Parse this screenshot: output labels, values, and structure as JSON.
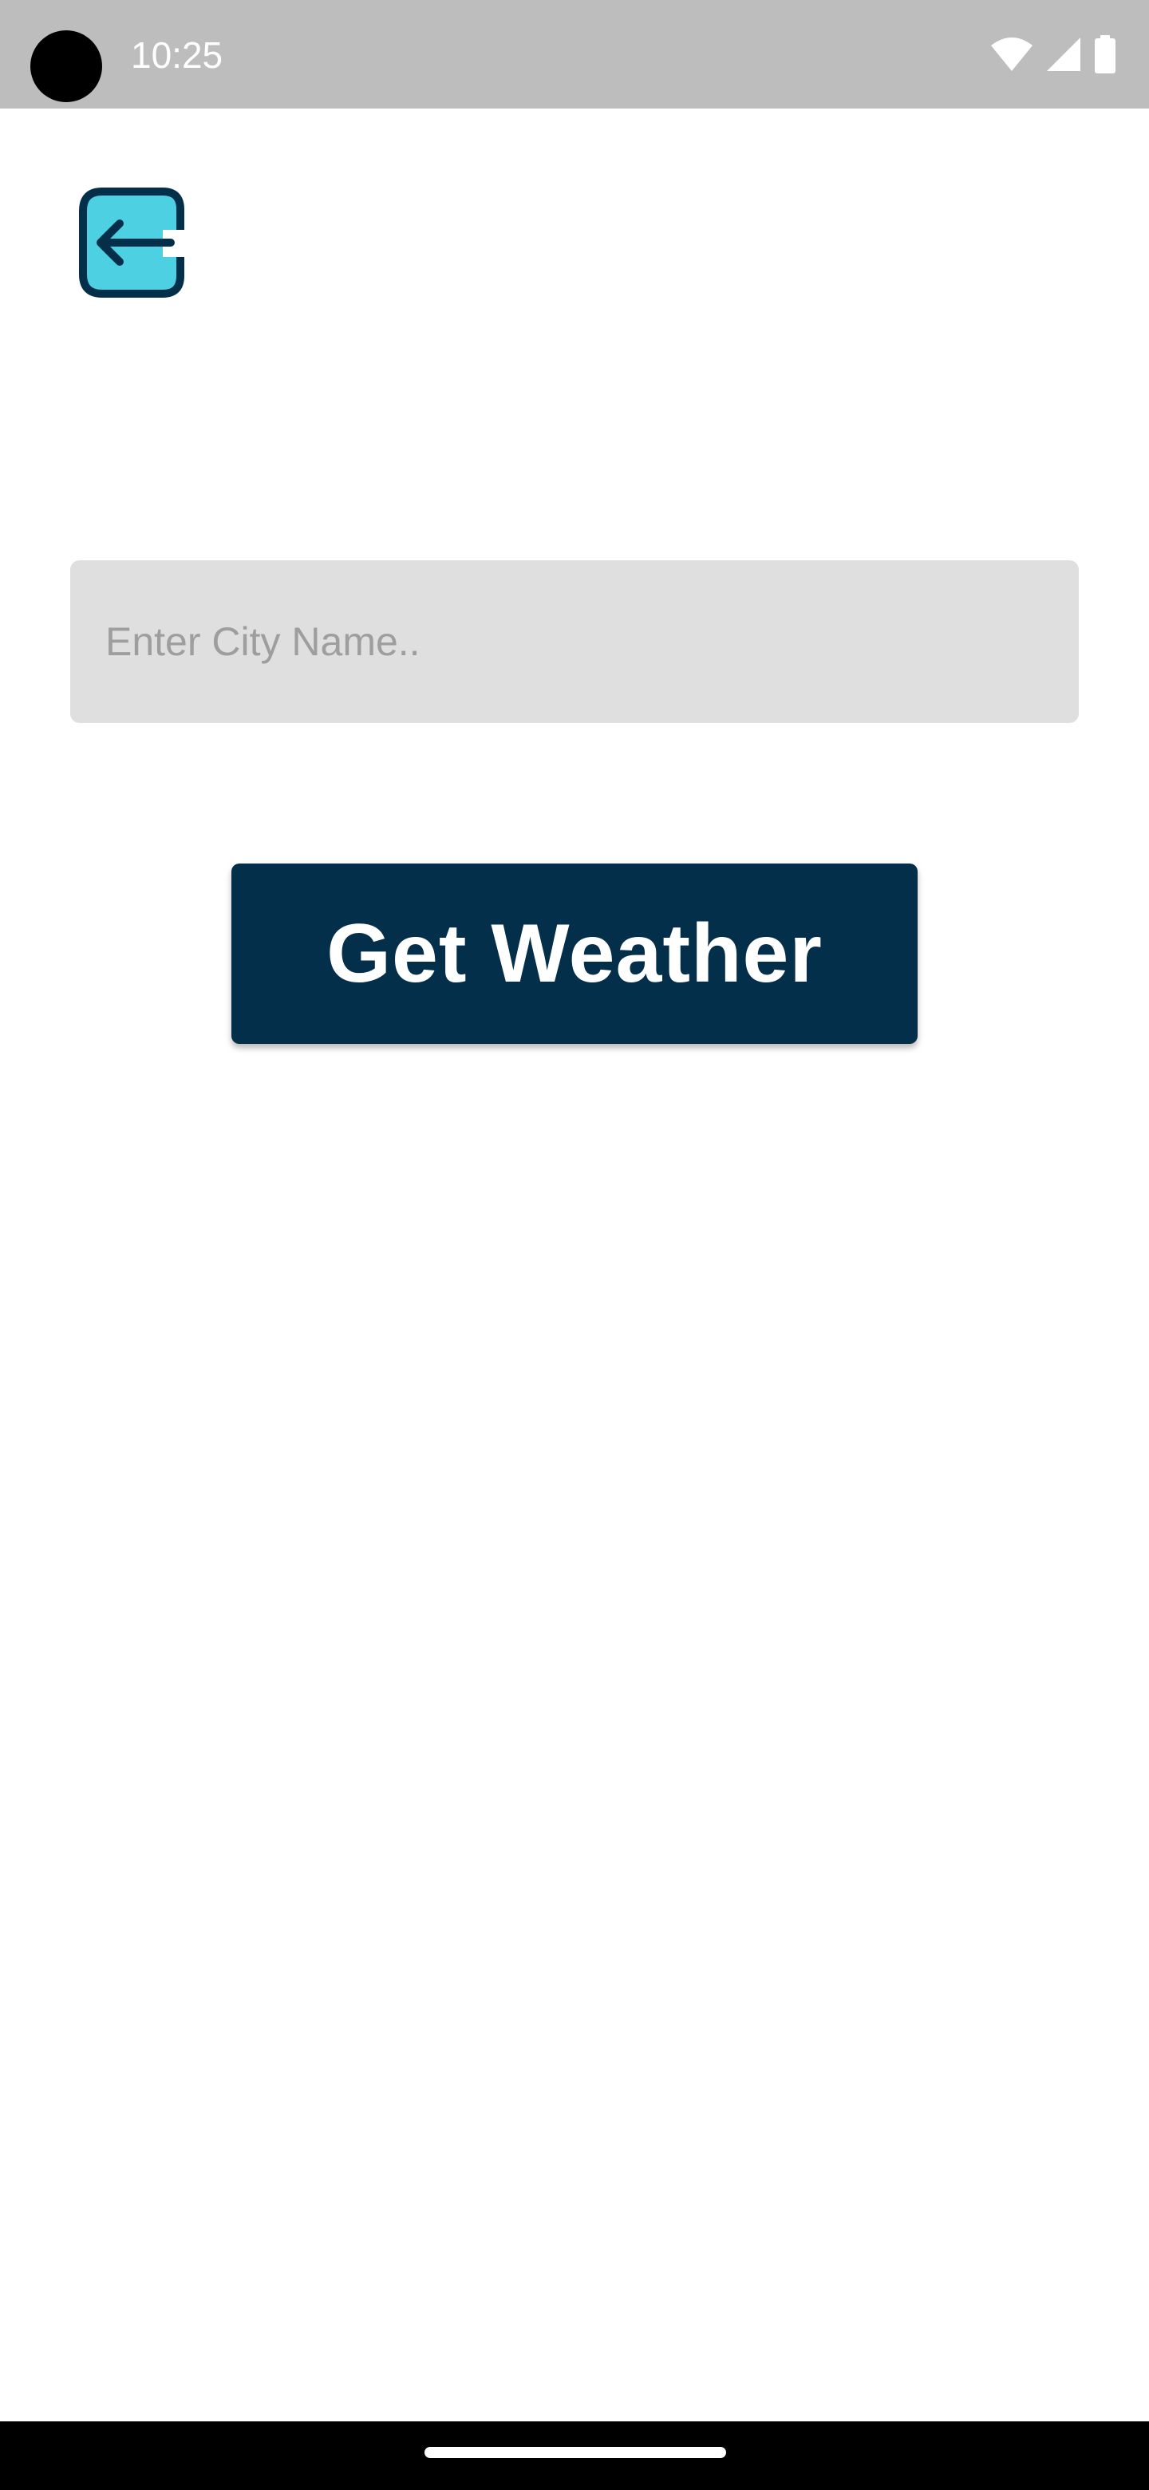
{
  "status_bar": {
    "time": "10:25",
    "icons": [
      "wifi-icon",
      "cellular-signal-icon",
      "battery-icon"
    ]
  },
  "back_button": {
    "icon": "back-arrow-icon",
    "colors": {
      "fill": "#4dd0e1",
      "stroke": "#042f4b"
    }
  },
  "search": {
    "placeholder": "Enter City Name..",
    "value": ""
  },
  "actions": {
    "get_weather_label": "Get Weather"
  },
  "colors": {
    "primary": "#042f4b",
    "accent": "#4dd0e1",
    "input_background": "#dfdfdf",
    "status_bar": "#bdbdbd",
    "background": "#ffffff"
  }
}
